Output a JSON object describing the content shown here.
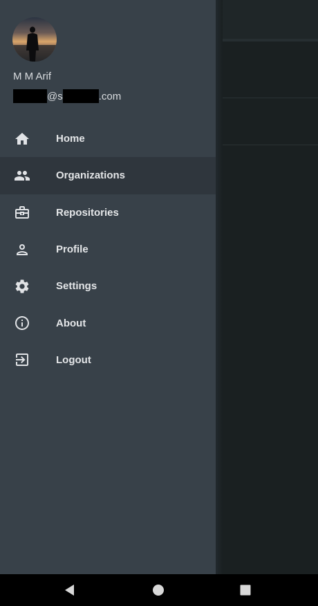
{
  "user": {
    "name": "M M Arif",
    "email_at": "@s",
    "email_suffix": ".com"
  },
  "menu": {
    "items": [
      {
        "label": "Home",
        "icon": "home-icon"
      },
      {
        "label": "Organizations",
        "icon": "people-icon",
        "active": true
      },
      {
        "label": "Repositories",
        "icon": "briefcase-icon"
      },
      {
        "label": "Profile",
        "icon": "person-icon"
      },
      {
        "label": "Settings",
        "icon": "gear-icon"
      },
      {
        "label": "About",
        "icon": "info-icon"
      },
      {
        "label": "Logout",
        "icon": "exit-icon"
      }
    ]
  },
  "navbar": {
    "buttons": [
      "back-icon",
      "home-circle-icon",
      "recents-square-icon"
    ]
  },
  "colors": {
    "drawer_bg": "#384149",
    "active_item_bg": "#2f363d",
    "app_bg": "#1a2021",
    "text": "#e4e6e8"
  }
}
